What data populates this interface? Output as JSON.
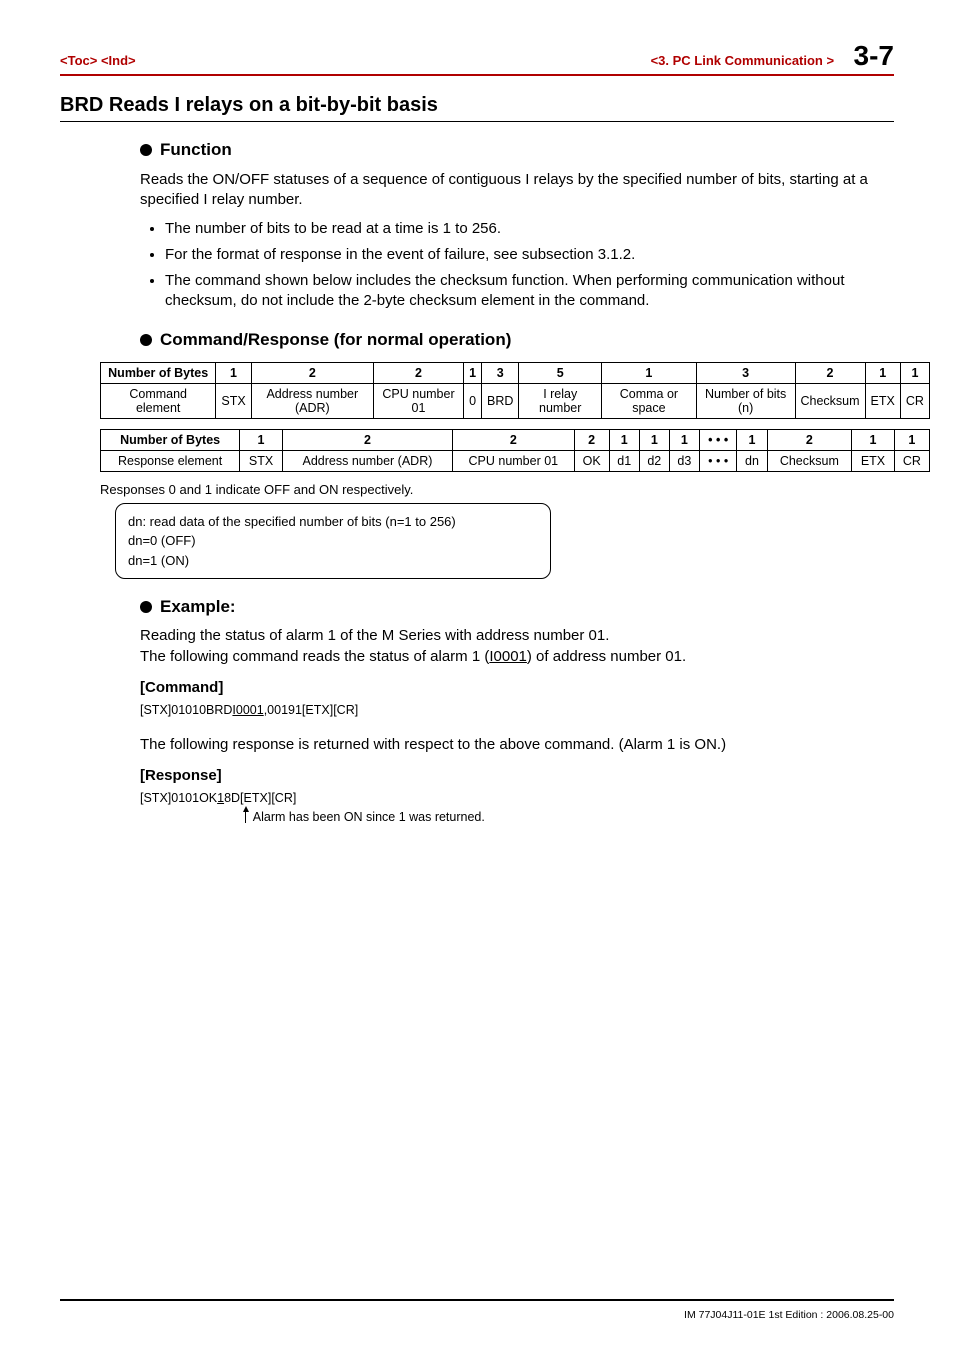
{
  "header": {
    "toc": "<Toc> <Ind>",
    "section": "<3.  PC Link Communication >",
    "page": "3-7"
  },
  "title": "BRD   Reads I relays on a bit-by-bit basis",
  "function": {
    "heading": "Function",
    "para": "Reads the ON/OFF statuses of a sequence of contiguous I relays by the specified number of bits, starting at a specified I relay number.",
    "bul1": "The number of bits to be read at a time is 1 to 256.",
    "bul2": "For the format of response in the event of failure, see subsection 3.1.2.",
    "bul3": "The command shown below includes the checksum function. When performing communication without checksum, do not include the 2-byte checksum element in the command."
  },
  "cmdresp": {
    "heading": "Command/Response (for normal operation)"
  },
  "table1": {
    "rowlabel": "Number of Bytes",
    "bytes": [
      "1",
      "2",
      "2",
      "1",
      "3",
      "5",
      "1",
      "3",
      "2",
      "1",
      "1"
    ],
    "elabel": "Command element",
    "cells": [
      "STX",
      "Address number (ADR)",
      "CPU number 01",
      "0",
      "BRD",
      "I relay number",
      "Comma or space",
      "Number of bits (n)",
      "Checksum",
      "ETX",
      "CR"
    ]
  },
  "table2": {
    "rowlabel": "Number of Bytes",
    "bytes": [
      "1",
      "2",
      "2",
      "2",
      "1",
      "1",
      "1",
      "• • •",
      "1",
      "2",
      "1",
      "1"
    ],
    "elabel": "Response element",
    "cells": [
      "STX",
      "Address number (ADR)",
      "CPU number 01",
      "OK",
      "d1",
      "d2",
      "d3",
      "• • •",
      "dn",
      "Checksum",
      "ETX",
      "CR"
    ]
  },
  "note": "Responses 0 and 1 indicate OFF and ON respectively.",
  "callout": {
    "l1": "dn: read data of the specified number of bits (n=1 to 256)",
    "l2": "dn=0 (OFF)",
    "l3": "dn=1 (ON)"
  },
  "example": {
    "heading": "Example:",
    "line1": "Reading the status of alarm 1 of the M Series with address number 01.",
    "line2a": "The following command reads the status of alarm 1 (",
    "line2u": "I0001",
    "line2b": ") of address number 01.",
    "cmd_label": "[Command]",
    "cmd_code_a": "[STX]01010BRD",
    "cmd_code_u": "I0001",
    "cmd_code_b": ",00191[ETX][CR]",
    "resp_intro": "The following response is returned with respect to the above command. (Alarm 1 is ON.)",
    "resp_label": "[Response]",
    "resp_code_a": "[STX]0101OK",
    "resp_code_u": "1",
    "resp_code_b": "8D[ETX][CR]",
    "arrow_note": "Alarm has been ON since 1 was returned."
  },
  "footer": "IM 77J04J11-01E  1st Edition : 2006.08.25-00"
}
